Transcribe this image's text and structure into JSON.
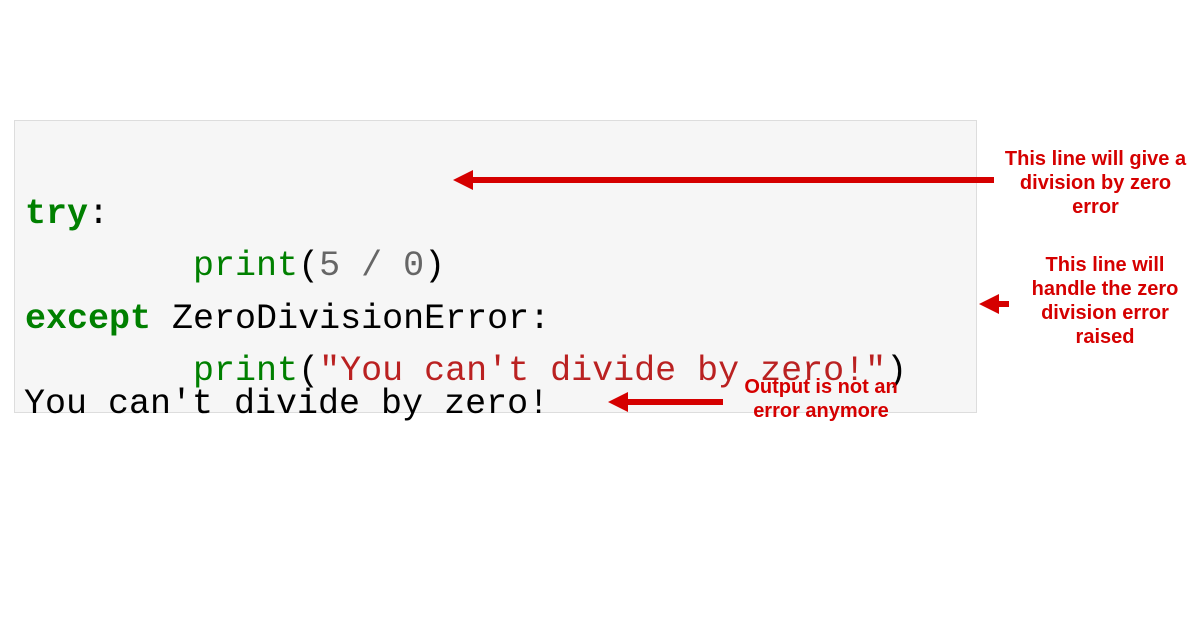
{
  "code": {
    "kw_try": "try",
    "colon1": ":",
    "indent": "        ",
    "func_print1": "print",
    "paren_open1": "(",
    "num_5": "5",
    "space1": " ",
    "op_div": "/",
    "space2": " ",
    "num_0": "0",
    "paren_close1": ")",
    "kw_except": "except",
    "space3": " ",
    "err_name": "ZeroDivisionError",
    "colon2": ":",
    "func_print2": "print",
    "paren_open2": "(",
    "string_msg": "\"You can't divide by zero!\"",
    "paren_close2": ")"
  },
  "output": "You can't divide by zero!",
  "annotations": {
    "line1": "This line will give a division by zero error",
    "line2": "This line will handle the zero division error raised",
    "line3": "Output is not an error anymore"
  },
  "colors": {
    "annotation": "#d50000",
    "keyword": "#008000",
    "string": "#ba2121",
    "codebg": "#f6f6f6"
  }
}
